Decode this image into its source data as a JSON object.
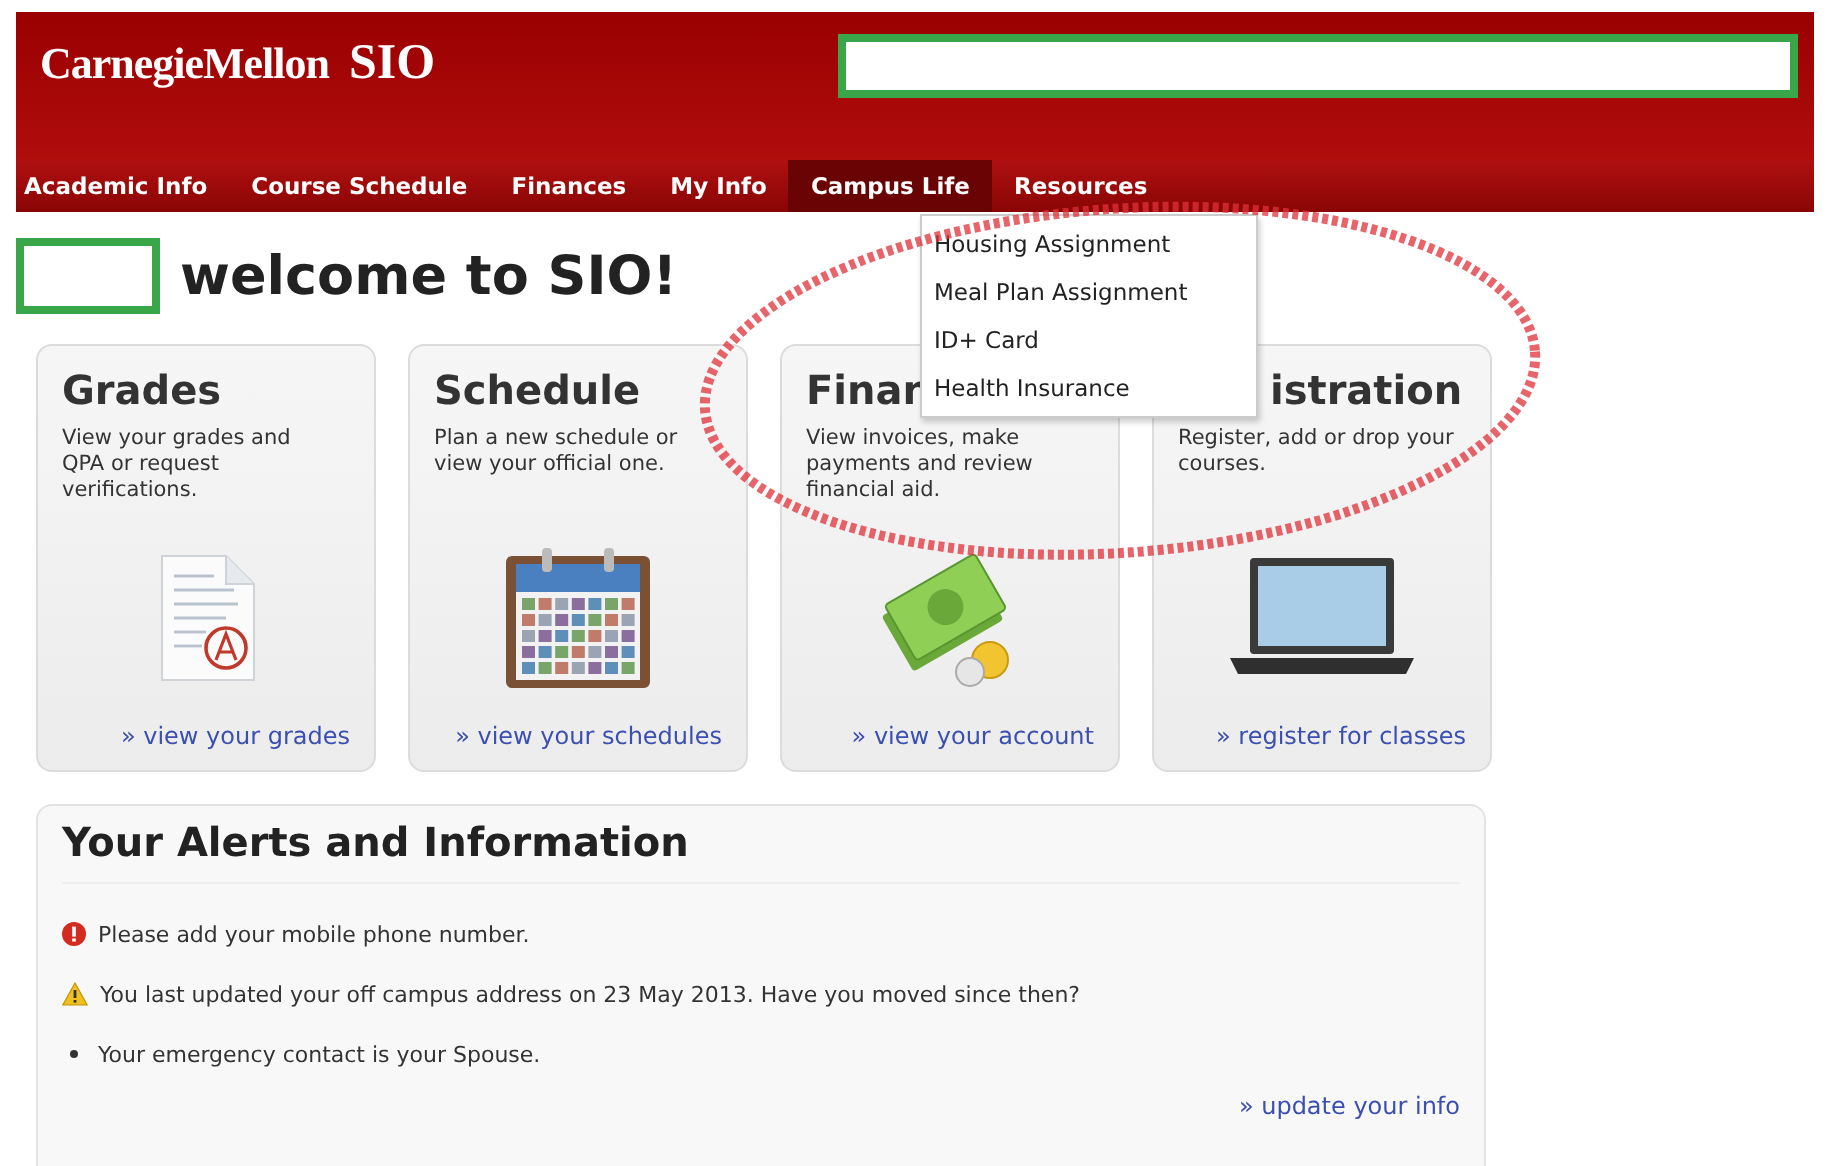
{
  "header": {
    "logo_name": "CarnegieMellon",
    "logo_app": "SIO"
  },
  "nav": [
    {
      "label": "Academic Info",
      "selected": false
    },
    {
      "label": "Course Schedule",
      "selected": false
    },
    {
      "label": "Finances",
      "selected": false
    },
    {
      "label": "My Info",
      "selected": false
    },
    {
      "label": "Campus Life",
      "selected": true
    },
    {
      "label": "Resources",
      "selected": false
    }
  ],
  "dropdown": [
    "Housing Assignment",
    "Meal Plan Assignment",
    "ID+ Card",
    "Health Insurance"
  ],
  "welcome": "welcome to SIO!",
  "cards": [
    {
      "title": "Grades",
      "description": "View your grades and QPA or request verifications.",
      "link": "» view your grades"
    },
    {
      "title": "Schedule",
      "description": "Plan a new schedule or view your official one.",
      "link": "» view your schedules"
    },
    {
      "title": "Finan",
      "description": "View invoices, make payments and review financial aid.",
      "link": "» view your account"
    },
    {
      "title": "istration",
      "description": "Register, add or drop your courses.",
      "link": "» register for classes"
    }
  ],
  "alerts": {
    "title": "Your Alerts and Information",
    "items": [
      {
        "kind": "error",
        "text": "Please add your mobile phone number."
      },
      {
        "kind": "warning",
        "text": "You last updated your off campus address on 23 May 2013. Have you moved since then?"
      },
      {
        "kind": "bullet",
        "text": "Your emergency contact is your Spouse."
      }
    ],
    "link": "» update your info"
  }
}
